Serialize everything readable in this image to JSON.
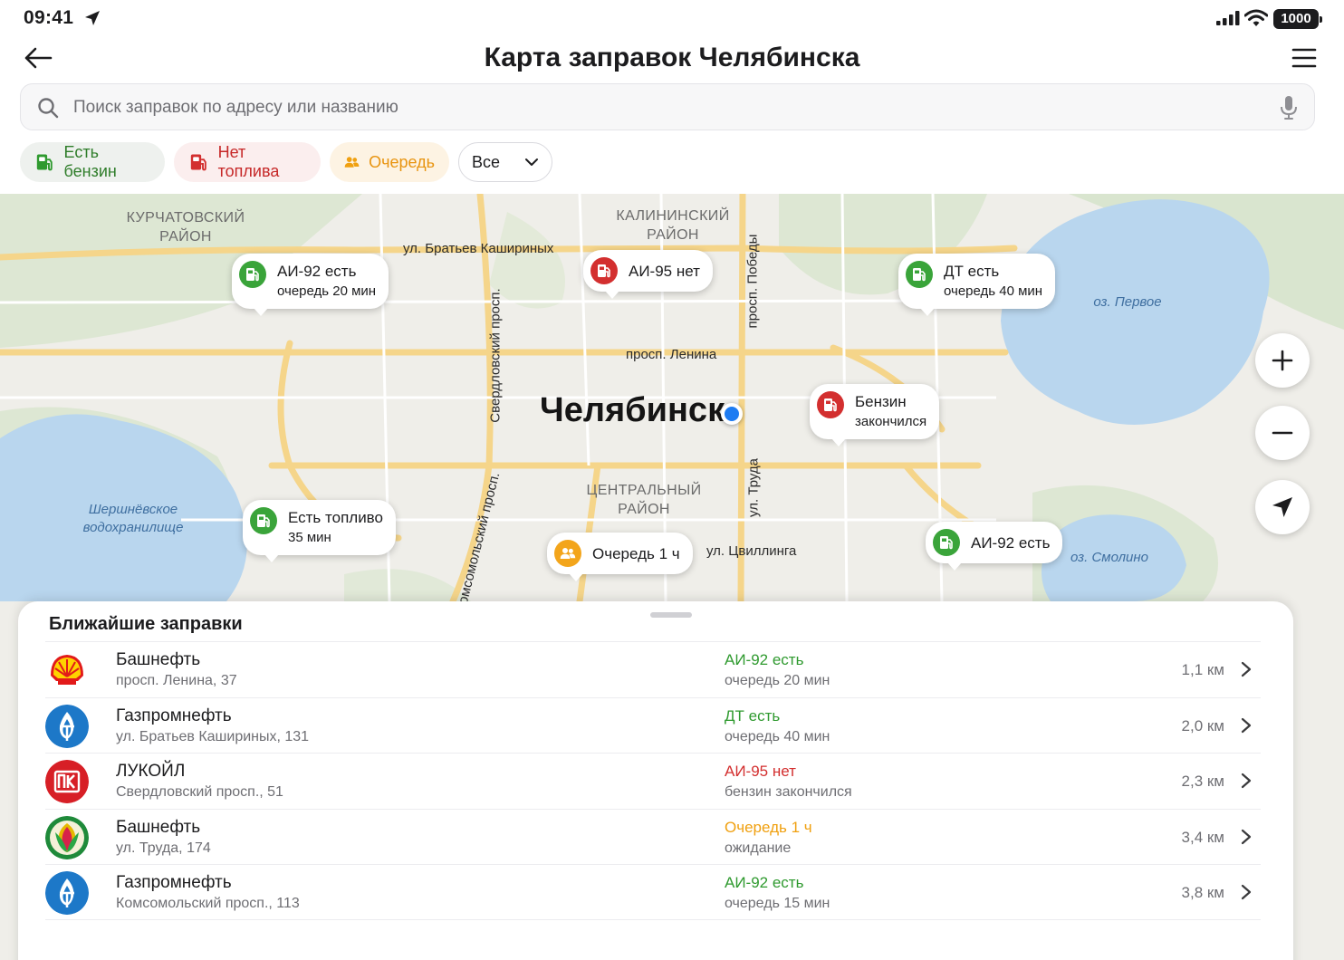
{
  "status_bar": {
    "time": "09:41",
    "battery": "1000"
  },
  "header": {
    "title": "Карта заправок Челябинска"
  },
  "search": {
    "placeholder": "Поиск заправок по адресу или названию"
  },
  "filters": {
    "fuel_available": "Есть бензин",
    "no_fuel": "Нет топлива",
    "queue": "Очередь",
    "select_value": "Все"
  },
  "map": {
    "city": "Челябинск",
    "districts": {
      "kurchatovsky": "КУРЧАТОВСКИЙ\nРАЙОН",
      "kalininsky": "КАЛИНИНСКИЙ\nРАЙОН",
      "central": "ЦЕНТРАЛЬНЫЙ\nРАЙОН"
    },
    "streets": {
      "kashirinykh": "ул. Братьев Кашириных",
      "sverdlovsky": "Свердловский просп.",
      "pobedy": "просп. Победы",
      "lenina": "просп. Ленина",
      "truda": "ул. Труда",
      "tsvillinga": "ул. Цвиллинга",
      "komsomolsky": "Комсомольский просп."
    },
    "lakes": {
      "pervoe": "оз. Первое",
      "smolino": "оз. Смолино",
      "shershnevskoe": "Шершнёвское\nводохранилище"
    },
    "markers": [
      {
        "line1": "АИ-92 есть",
        "line2": "очередь 20 мин",
        "status": "green"
      },
      {
        "line1": "АИ-95 нет",
        "line2": "",
        "status": "red"
      },
      {
        "line1": "ДТ есть",
        "line2": "очередь 40 мин",
        "status": "green"
      },
      {
        "line1": "Бензин",
        "line2": "закончился",
        "status": "red"
      },
      {
        "line1": "Есть топливо",
        "line2": "35 мин",
        "status": "green"
      },
      {
        "line1": "Очередь 1 ч",
        "line2": "",
        "status": "orange"
      },
      {
        "line1": "АИ-92 есть",
        "line2": "",
        "status": "green"
      }
    ]
  },
  "sheet": {
    "title": "Ближайшие заправки",
    "stations": [
      {
        "name": "Башнефть",
        "address": "просп. Ленина, 37",
        "status": "АИ-92 есть",
        "note": "очередь 20 мин",
        "distance": "1,1 км",
        "logo": "shell-logo",
        "color": "#2f9a2f"
      },
      {
        "name": "Газпромнефть",
        "address": "ул. Братьев Кашириных, 131",
        "status": "ДТ есть",
        "note": "очередь 40 мин",
        "distance": "2,0 км",
        "logo": "gazpromneft-logo",
        "color": "#2f9a2f"
      },
      {
        "name": "ЛУКОЙЛ",
        "address": "Свердловский просп., 51",
        "status": "АИ-95 нет",
        "note": "бензин закончился",
        "distance": "2,3 км",
        "logo": "lukoil-logo",
        "color": "#d32f2f"
      },
      {
        "name": "Башнефть",
        "address": "ул. Труда, 174",
        "status": "Очередь 1 ч",
        "note": "ожидание",
        "distance": "3,4 км",
        "logo": "bashneft-logo",
        "color": "#f0a010"
      },
      {
        "name": "Газпромнефть",
        "address": "Комсомольский просп., 113",
        "status": "АИ-92 есть",
        "note": "очередь 15 мин",
        "distance": "3,8 км",
        "logo": "gazpromneft-logo",
        "color": "#2f9a2f"
      }
    ]
  }
}
